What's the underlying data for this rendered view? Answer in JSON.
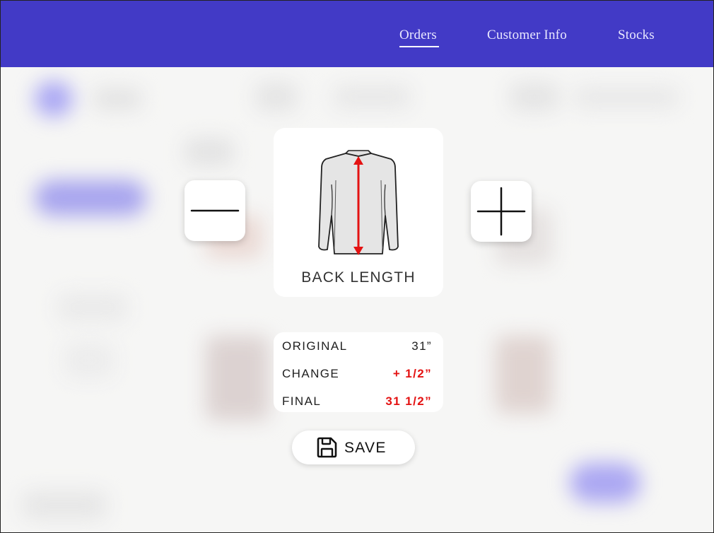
{
  "nav": {
    "items": [
      {
        "label": "Orders",
        "active": true
      },
      {
        "label": "Customer Info",
        "active": false
      },
      {
        "label": "Stocks",
        "active": false
      }
    ]
  },
  "colors": {
    "nav_bg": "#423ac6",
    "measure_arrow": "#e41212",
    "change_text": "#e41212"
  },
  "icons": {
    "decrease": "minus-icon",
    "increase": "plus-icon",
    "garment": "jacket-back-icon",
    "save": "floppy-disk-icon"
  },
  "measurement": {
    "title": "BACK LENGTH",
    "rows": [
      {
        "label": "ORIGINAL",
        "value": "31”"
      },
      {
        "label": "CHANGE",
        "value": "+ 1/2”"
      },
      {
        "label": "FINAL",
        "value": "31 1/2”"
      }
    ]
  },
  "actions": {
    "save_label": "SAVE"
  }
}
